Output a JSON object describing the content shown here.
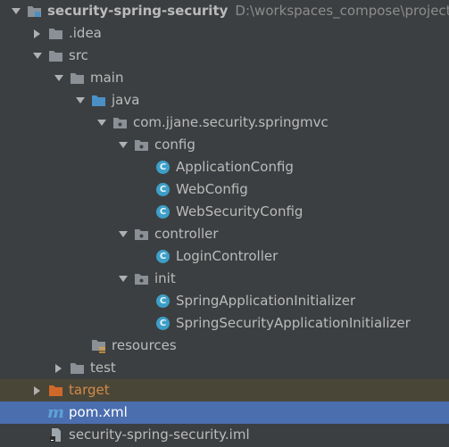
{
  "project_tree": {
    "items": [
      {
        "id": "root",
        "label": "security-spring-security",
        "path": "D:\\workspaces_compose\\projecto",
        "icon": "module-folder-icon",
        "arrow": "down",
        "indent": 0
      },
      {
        "id": "idea",
        "label": ".idea",
        "icon": "folder-icon",
        "arrow": "right",
        "indent": 1
      },
      {
        "id": "src",
        "label": "src",
        "icon": "folder-icon",
        "arrow": "down",
        "indent": 1
      },
      {
        "id": "main",
        "label": "main",
        "icon": "folder-icon",
        "arrow": "down",
        "indent": 2
      },
      {
        "id": "java",
        "label": "java",
        "icon": "source-folder-icon",
        "arrow": "down",
        "indent": 3
      },
      {
        "id": "pkg",
        "label": "com.jjane.security.springmvc",
        "icon": "package-icon",
        "arrow": "down",
        "indent": 4
      },
      {
        "id": "config",
        "label": "config",
        "icon": "package-icon",
        "arrow": "down",
        "indent": 5
      },
      {
        "id": "appconfig",
        "label": "ApplicationConfig",
        "icon": "java-class-icon",
        "arrow": "none",
        "indent": 6
      },
      {
        "id": "webconfig",
        "label": "WebConfig",
        "icon": "java-class-icon",
        "arrow": "none",
        "indent": 6
      },
      {
        "id": "websecconfig",
        "label": "WebSecurityConfig",
        "icon": "java-class-icon",
        "arrow": "none",
        "indent": 6
      },
      {
        "id": "controller",
        "label": "controller",
        "icon": "package-icon",
        "arrow": "down",
        "indent": 5
      },
      {
        "id": "logincontroller",
        "label": "LoginController",
        "icon": "java-class-icon",
        "arrow": "none",
        "indent": 6
      },
      {
        "id": "init",
        "label": "init",
        "icon": "package-icon",
        "arrow": "down",
        "indent": 5
      },
      {
        "id": "springappinit",
        "label": "SpringApplicationInitializer",
        "icon": "java-class-icon",
        "arrow": "none",
        "indent": 6
      },
      {
        "id": "springsecinit",
        "label": "SpringSecurityApplicationInitializer",
        "icon": "java-class-icon",
        "arrow": "none",
        "indent": 6
      },
      {
        "id": "resources",
        "label": "resources",
        "icon": "resources-folder-icon",
        "arrow": "none",
        "indent": 3
      },
      {
        "id": "test",
        "label": "test",
        "icon": "folder-icon",
        "arrow": "right",
        "indent": 2
      },
      {
        "id": "target",
        "label": "target",
        "icon": "excluded-folder-icon",
        "arrow": "right",
        "indent": 1,
        "state": "excluded"
      },
      {
        "id": "pom",
        "label": "pom.xml",
        "icon": "maven-icon",
        "arrow": "none",
        "indent": 1,
        "state": "selected"
      },
      {
        "id": "iml",
        "label": "security-spring-security.iml",
        "icon": "iml-file-icon",
        "arrow": "none",
        "indent": 1
      }
    ]
  },
  "class_badge_letter": "C",
  "maven_letter": "m",
  "colors": {
    "background": "#3c3f41",
    "selection": "#4b6eaf",
    "excluded_row": "#4a4637",
    "folder": "#8a9096",
    "source_folder": "#4a90c6",
    "excluded_folder": "#d0682a",
    "class_badge": "#3d9fc7",
    "maven": "#5fa3d6"
  }
}
